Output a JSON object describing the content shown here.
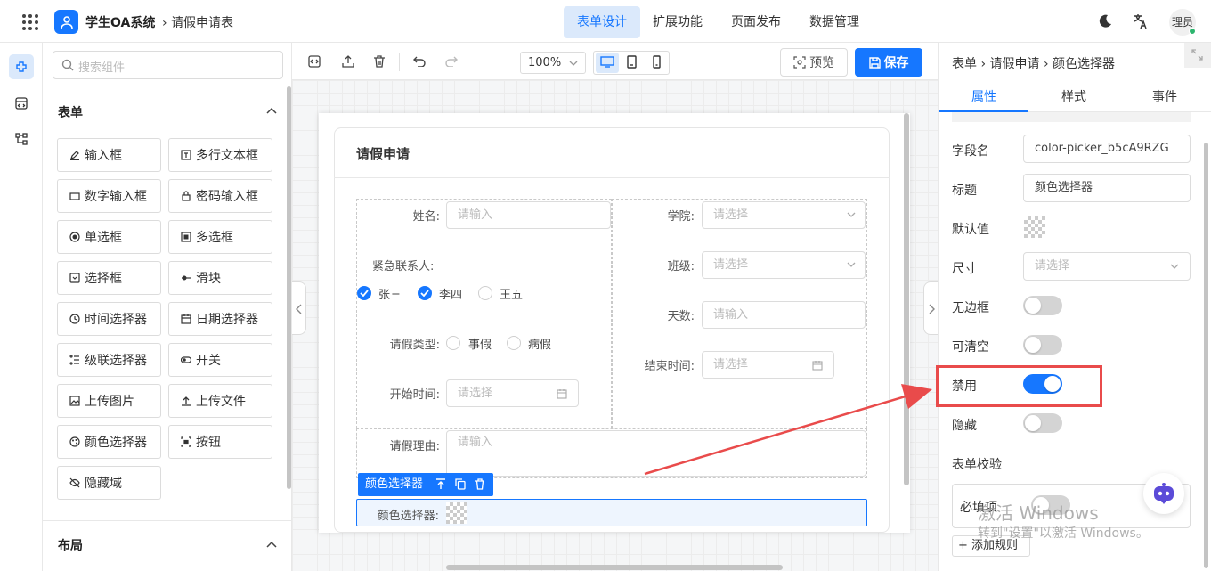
{
  "app": {
    "title": "学生OA系统",
    "breadcrumb": "请假申请表"
  },
  "header": {
    "tabs": [
      "表单设计",
      "扩展功能",
      "页面发布",
      "数据管理"
    ],
    "active_tab": "表单设计",
    "user": "理员"
  },
  "palette": {
    "search_placeholder": "搜索组件",
    "section_form": "表单",
    "section_layout": "布局",
    "items": [
      "输入框",
      "多行文本框",
      "数字输入框",
      "密码输入框",
      "单选框",
      "多选框",
      "选择框",
      "滑块",
      "时间选择器",
      "日期选择器",
      "级联选择器",
      "开关",
      "上传图片",
      "上传文件",
      "颜色选择器",
      "按钮",
      "隐藏域"
    ]
  },
  "toolbar": {
    "zoom": "100%",
    "preview": "预览",
    "save": "保存"
  },
  "form": {
    "title": "请假申请",
    "name_label": "姓名:",
    "name_ph": "请输入",
    "college_label": "学院:",
    "college_ph": "请选择",
    "contact_label": "紧急联系人:",
    "contacts": [
      {
        "label": "张三",
        "checked": true
      },
      {
        "label": "李四",
        "checked": true
      },
      {
        "label": "王五",
        "checked": false
      }
    ],
    "class_label": "班级:",
    "class_ph": "请选择",
    "days_label": "天数:",
    "days_ph": "请输入",
    "leave_type_label": "请假类型:",
    "leave_types": [
      "事假",
      "病假"
    ],
    "end_label": "结束时间:",
    "end_ph": "请选择",
    "start_label": "开始时间:",
    "start_ph": "请选择",
    "reason_label": "请假理由:",
    "reason_ph": "请输入",
    "selected_chip": "颜色选择器",
    "color_label": "颜色选择器:"
  },
  "props": {
    "breadcrumb": [
      "表单",
      "请假申请",
      "颜色选择器"
    ],
    "tabs": [
      "属性",
      "样式",
      "事件"
    ],
    "field_name_label": "字段名",
    "field_name": "color-picker_b5cA9RZG",
    "title_label": "标题",
    "title": "颜色选择器",
    "default_label": "默认值",
    "size_label": "尺寸",
    "size_ph": "请选择",
    "borderless_label": "无边框",
    "borderless": false,
    "clearable_label": "可清空",
    "clearable": false,
    "disabled_label": "禁用",
    "disabled": true,
    "hidden_label": "隐藏",
    "hidden": false,
    "validation_label": "表单校验",
    "required_label": "必填项",
    "required": false,
    "add_rule": "+ 添加规则"
  },
  "watermark": {
    "line1": "激活 Windows",
    "line2": "转到\"设置\"以激活 Windows。"
  },
  "colors": {
    "accent": "#1677ff",
    "highlight": "#e94b4b"
  }
}
